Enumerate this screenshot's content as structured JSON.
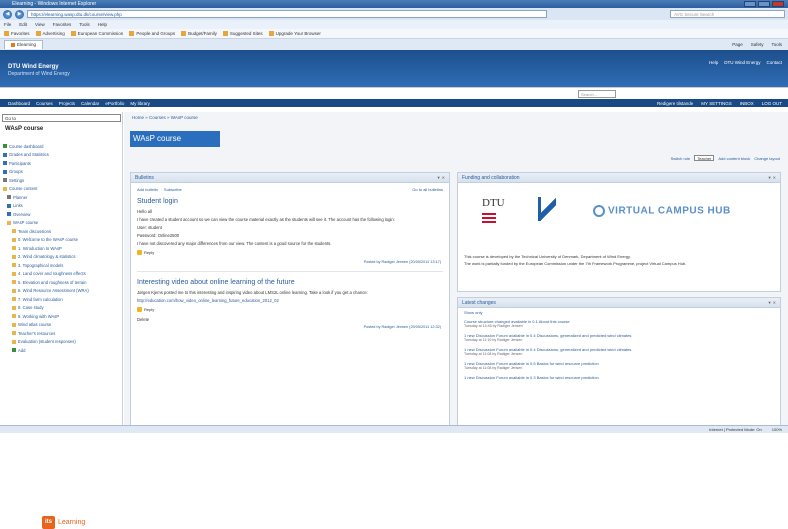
{
  "browser": {
    "window_title": "Elearning - Windows Internet Explorer",
    "url": "https://elearning.wasp.dtu.dk/course/view.php",
    "search_placeholder": "AVG Secure Search",
    "menu": [
      "File",
      "Edit",
      "View",
      "Favorites",
      "Tools",
      "Help"
    ],
    "favorites": [
      "Favorites",
      "Advertising",
      "European Commission",
      "People and Groups",
      "Budget/Family",
      "Suggested Sites",
      "Upgrade Your Browser"
    ],
    "tab_label": "Elearning",
    "tab_tools": [
      "Page",
      "Safety",
      "Tools"
    ],
    "status_left": "",
    "status_right": [
      "Internet | Protected Mode: On",
      "100%"
    ]
  },
  "site": {
    "brand": "DTU Wind Energy",
    "brand_sub": "Department of Wind Energy",
    "header_links": [
      "Help",
      "DTU Wind Energy",
      "Contact"
    ],
    "nav_items": [
      "Dashboard",
      "Courses",
      "Projects",
      "Calendar",
      "ePortfolio",
      "My library"
    ],
    "search_placeholder": "Search...",
    "user_links": [
      "Redigere tilstande",
      "MY SETTINGS",
      "INBOX",
      "LOG OUT"
    ]
  },
  "left": {
    "course_select": "Go to",
    "heading": "WAsP course",
    "subheading": "",
    "items": [
      {
        "label": "Course dashboard",
        "icon": "dashboard-icon",
        "level": 0
      },
      {
        "label": "Grades and Statistics",
        "icon": "grades-icon",
        "level": 0
      },
      {
        "label": "Participants",
        "icon": "participants-icon",
        "level": 0
      },
      {
        "label": "Groups",
        "icon": "groups-icon",
        "level": 0
      },
      {
        "label": "Settings",
        "icon": "gear-icon",
        "level": 0
      },
      {
        "label": "Course content",
        "icon": "folder-icon",
        "level": 0
      },
      {
        "label": "Planner",
        "icon": "calendar-icon",
        "level": 1
      },
      {
        "label": "Links",
        "icon": "link-icon",
        "level": 1
      },
      {
        "label": "Overview",
        "icon": "overview-icon",
        "level": 1
      },
      {
        "label": "WAsP course",
        "icon": "folder-icon",
        "level": 1
      },
      {
        "label": "Team discussions",
        "icon": "folder-icon",
        "level": 2
      },
      {
        "label": "0. Welcome to the WAsP course",
        "icon": "folder-icon",
        "level": 2
      },
      {
        "label": "1. Introduction to WAsP",
        "icon": "folder-icon",
        "level": 2
      },
      {
        "label": "2. Wind climatology & statistics",
        "icon": "folder-icon",
        "level": 2
      },
      {
        "label": "3. Topographical models",
        "icon": "folder-icon",
        "level": 2
      },
      {
        "label": "4. Land cover and roughness effects",
        "icon": "folder-icon",
        "level": 2
      },
      {
        "label": "5. Elevation and roughness of terrain",
        "icon": "folder-icon",
        "level": 2
      },
      {
        "label": "6. Wind Resource Assessment (WRA)",
        "icon": "folder-icon",
        "level": 2
      },
      {
        "label": "7. Wind farm calculation",
        "icon": "folder-icon",
        "level": 2
      },
      {
        "label": "8. Case study",
        "icon": "folder-icon",
        "level": 2
      },
      {
        "label": "9. Working with WAsP",
        "icon": "folder-icon",
        "level": 2
      },
      {
        "label": "Wind atlas course",
        "icon": "folder-icon",
        "level": 2
      },
      {
        "label": "Teacher's resources",
        "icon": "folder-icon",
        "level": 2
      },
      {
        "label": "Evaluation (student responses)",
        "icon": "folder-icon",
        "level": 2
      },
      {
        "label": "Add",
        "icon": "add-icon",
        "level": 2
      }
    ],
    "logo_text": "Learning",
    "logo_mark": "its"
  },
  "main": {
    "breadcrumb": "Home » Courses » WAsP course",
    "course_title": "WAsP course",
    "switch_role_label": "Switch role",
    "switch_role_value": "Teacher",
    "add_content_link": "Add content block",
    "change_layout_link": "Change layout",
    "bulletins": {
      "title": "Bulletins",
      "controls": [
        "Add bulletin",
        "Subscribe"
      ],
      "right_link": "Go to all bulletins",
      "posts": [
        {
          "title": "Student login",
          "lines": [
            "Hello all",
            "I have created a student account so we can view the course material exactly as the students will see it. The account has the following login:",
            "User: student",
            "Password: Online2500",
            "I have not discovered any major differences from our view. The content is a good source for the students."
          ],
          "reply_label": "Reply",
          "meta": "Posted by Radiger Jensen (20/05/2011 13:17)"
        },
        {
          "title": "Interesting video about online learning of the future",
          "lines": [
            "Jørgen Kjems posted me to this interesting and inspiring video about LMS2L online learning. Take a look if you get a chance:",
            "http://education.com/how_video_online_learning_future_education_2012_02"
          ],
          "reply_label": "Reply",
          "extra": "Delete",
          "meta": "Posted by Radiger Jensen (29/05/2011 12:32)"
        }
      ]
    },
    "funding": {
      "title": "Funding and collaboration",
      "dtu_text": "DTU",
      "vch_text": "VIRTUAL CAMPUS HUB",
      "lines": [
        "This course is developed by the Technical University of Denmark, Department of Wind Energy.",
        "The work is partially funded by the European Commission under the 7th Framework Programme, project Virtual Campus Hub."
      ]
    },
    "latest": {
      "title": "Latest changes",
      "filter": "Show only",
      "items": [
        {
          "text": "Course structure changed available in 0.1 About this course",
          "time": "Tuesday at 14:45 by Radiger Jensen"
        },
        {
          "text": "1 new Discussion Forum available in 0.4 Discussions, generalized and predicted wind climates",
          "time": "Tuesday at 11:10 by Radiger Jensen"
        },
        {
          "text": "1 new Discussion Forum available in 0.4 Discussions, generalized and predicted wind climates",
          "time": "Tuesday at 11:08 by Radiger Jensen"
        },
        {
          "text": "1 new Discussion Forum available in 0.5 Basics for wind resource prediction",
          "time": "Tuesday at 11:08 by Radiger Jensen"
        },
        {
          "text": "1 new Discussion Forum available in 0.3 Basics for wind resource prediction",
          "time": ""
        }
      ]
    }
  }
}
